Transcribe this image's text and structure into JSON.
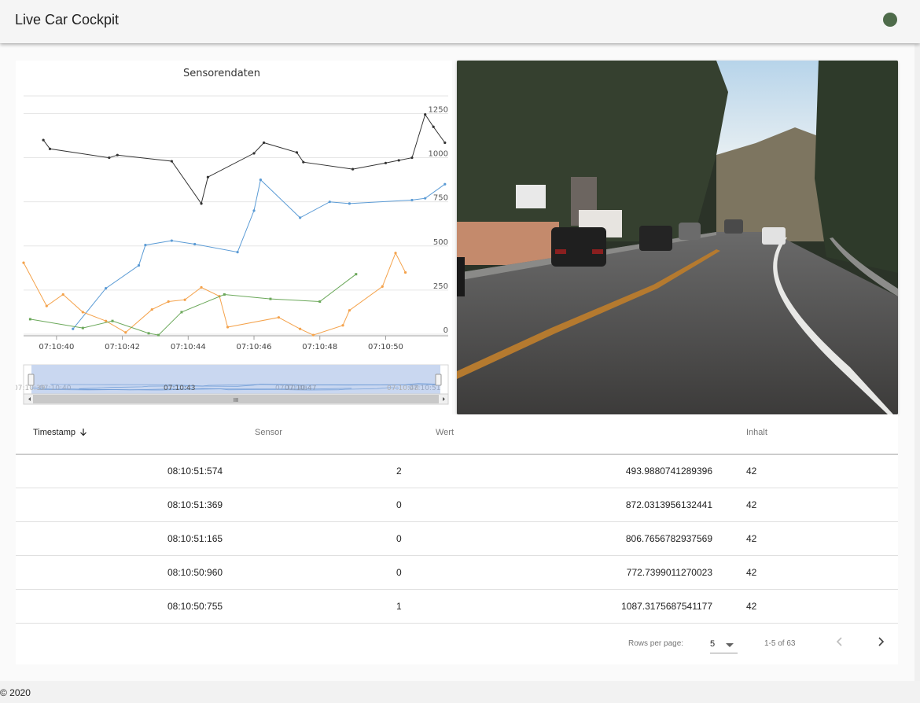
{
  "app": {
    "title": "Live Car Cockpit",
    "status_color": "#4e6b4a"
  },
  "chart_data": {
    "type": "line",
    "title": "Sensorendaten",
    "xlabel": "",
    "ylabel": "",
    "x_ticks": [
      "07:10:40",
      "07:10:42",
      "07:10:44",
      "07:10:46",
      "07:10:48",
      "07:10:50"
    ],
    "y_ticks": [
      "0",
      "250",
      "500",
      "750",
      "1000",
      "1250"
    ],
    "ylim": [
      0,
      1350
    ],
    "grid": true,
    "series": [
      {
        "color": "#333333",
        "marker": "circle",
        "points": [
          [
            39.6,
            1100
          ],
          [
            39.8,
            1050
          ],
          [
            41.6,
            1000
          ],
          [
            41.85,
            1015
          ],
          [
            43.5,
            980
          ],
          [
            44.4,
            740
          ],
          [
            44.6,
            890
          ],
          [
            46.0,
            1025
          ],
          [
            46.3,
            1085
          ],
          [
            47.3,
            1030
          ],
          [
            47.5,
            975
          ],
          [
            49.0,
            935
          ],
          [
            50.0,
            970
          ],
          [
            50.4,
            985
          ],
          [
            50.8,
            1000
          ],
          [
            51.2,
            1245
          ],
          [
            51.45,
            1175
          ],
          [
            51.8,
            1085
          ]
        ]
      },
      {
        "color": "#5b9bd5",
        "marker": "circle",
        "points": [
          [
            40.5,
            30
          ],
          [
            41.5,
            260
          ],
          [
            42.5,
            390
          ],
          [
            42.7,
            505
          ],
          [
            43.5,
            530
          ],
          [
            44.2,
            510
          ],
          [
            45.5,
            465
          ],
          [
            46.0,
            700
          ],
          [
            46.2,
            875
          ],
          [
            47.4,
            660
          ],
          [
            48.3,
            750
          ],
          [
            48.9,
            740
          ],
          [
            50.8,
            760
          ],
          [
            51.2,
            770
          ],
          [
            51.8,
            850
          ]
        ]
      },
      {
        "color": "#f4a24b",
        "marker": "circle",
        "points": [
          [
            39.0,
            405
          ],
          [
            39.7,
            160
          ],
          [
            40.2,
            225
          ],
          [
            40.8,
            125
          ],
          [
            41.5,
            75
          ],
          [
            42.1,
            10
          ],
          [
            42.9,
            140
          ],
          [
            43.4,
            185
          ],
          [
            43.9,
            195
          ],
          [
            44.4,
            265
          ],
          [
            44.95,
            215
          ],
          [
            45.2,
            40
          ],
          [
            46.75,
            95
          ],
          [
            47.4,
            30
          ],
          [
            47.8,
            -5
          ],
          [
            48.7,
            50
          ],
          [
            48.9,
            135
          ],
          [
            49.9,
            270
          ],
          [
            50.3,
            460
          ],
          [
            50.6,
            350
          ]
        ]
      },
      {
        "color": "#6ba85a",
        "marker": "square",
        "points": [
          [
            39.2,
            85
          ],
          [
            40.8,
            35
          ],
          [
            41.7,
            75
          ],
          [
            42.8,
            5
          ],
          [
            43.1,
            -5
          ],
          [
            43.8,
            125
          ],
          [
            45.1,
            225
          ],
          [
            46.5,
            200
          ],
          [
            48.0,
            185
          ],
          [
            49.1,
            340
          ]
        ]
      }
    ],
    "zoom_slider": {
      "left_labels": [
        "07:10:39",
        "07:10:40"
      ],
      "mid_left_label": "07:10:43",
      "mid_labels": [
        "07:10:46",
        "07:10:47"
      ],
      "right_labels": [
        "07:10:48",
        "07:10:51"
      ]
    },
    "scroll_thumb_glyph": "III"
  },
  "camera": {
    "alt": "Frontkamera Live-Bild"
  },
  "table": {
    "headers": {
      "timestamp": "Timestamp",
      "sensor": "Sensor",
      "wert": "Wert",
      "inhalt": "Inhalt"
    },
    "rows": [
      {
        "timestamp": "08:10:51:574",
        "sensor": "2",
        "wert": "493.9880741289396",
        "inhalt": "42"
      },
      {
        "timestamp": "08:10:51:369",
        "sensor": "0",
        "wert": "872.0313956132441",
        "inhalt": "42"
      },
      {
        "timestamp": "08:10:51:165",
        "sensor": "0",
        "wert": "806.7656782937569",
        "inhalt": "42"
      },
      {
        "timestamp": "08:10:50:960",
        "sensor": "0",
        "wert": "772.7399011270023",
        "inhalt": "42"
      },
      {
        "timestamp": "08:10:50:755",
        "sensor": "1",
        "wert": "1087.3175687541177",
        "inhalt": "42"
      }
    ],
    "pagination": {
      "rows_per_page_label": "Rows per page:",
      "rows_per_page_value": "5",
      "range_text": "1-5 of 63"
    }
  },
  "footer": {
    "copyright": "© 2020"
  }
}
